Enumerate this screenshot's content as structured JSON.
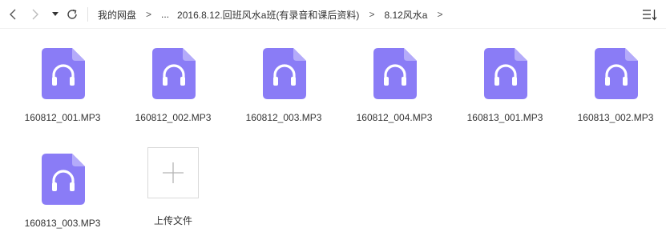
{
  "breadcrumb": {
    "root": "我的网盘",
    "sep1": ">",
    "ellipsis": "...",
    "folder1": "2016.8.12.回班风水a班(有录音和课后资料)",
    "sep2": ">",
    "folder2": "8.12风水a",
    "sep3": ">"
  },
  "toolbar": {
    "back_icon": "chevron-left-icon",
    "forward_icon": "chevron-right-icon",
    "history_icon": "caret-down-icon",
    "refresh_icon": "refresh-icon",
    "sort_icon": "sort-icon"
  },
  "files": [
    {
      "name": "160812_001.MP3",
      "type": "audio",
      "icon": "headphones-icon"
    },
    {
      "name": "160812_002.MP3",
      "type": "audio",
      "icon": "headphones-icon"
    },
    {
      "name": "160812_003.MP3",
      "type": "audio",
      "icon": "headphones-icon"
    },
    {
      "name": "160812_004.MP3",
      "type": "audio",
      "icon": "headphones-icon"
    },
    {
      "name": "160813_001.MP3",
      "type": "audio",
      "icon": "headphones-icon"
    },
    {
      "name": "160813_002.MP3",
      "type": "audio",
      "icon": "headphones-icon"
    },
    {
      "name": "160813_003.MP3",
      "type": "audio",
      "icon": "headphones-icon"
    }
  ],
  "upload": {
    "label": "上传文件",
    "icon": "plus-icon"
  },
  "colors": {
    "file_icon": "#8a7cf6",
    "file_fold": "#b4abfa",
    "text": "#333333",
    "border": "#d9d9d9"
  }
}
